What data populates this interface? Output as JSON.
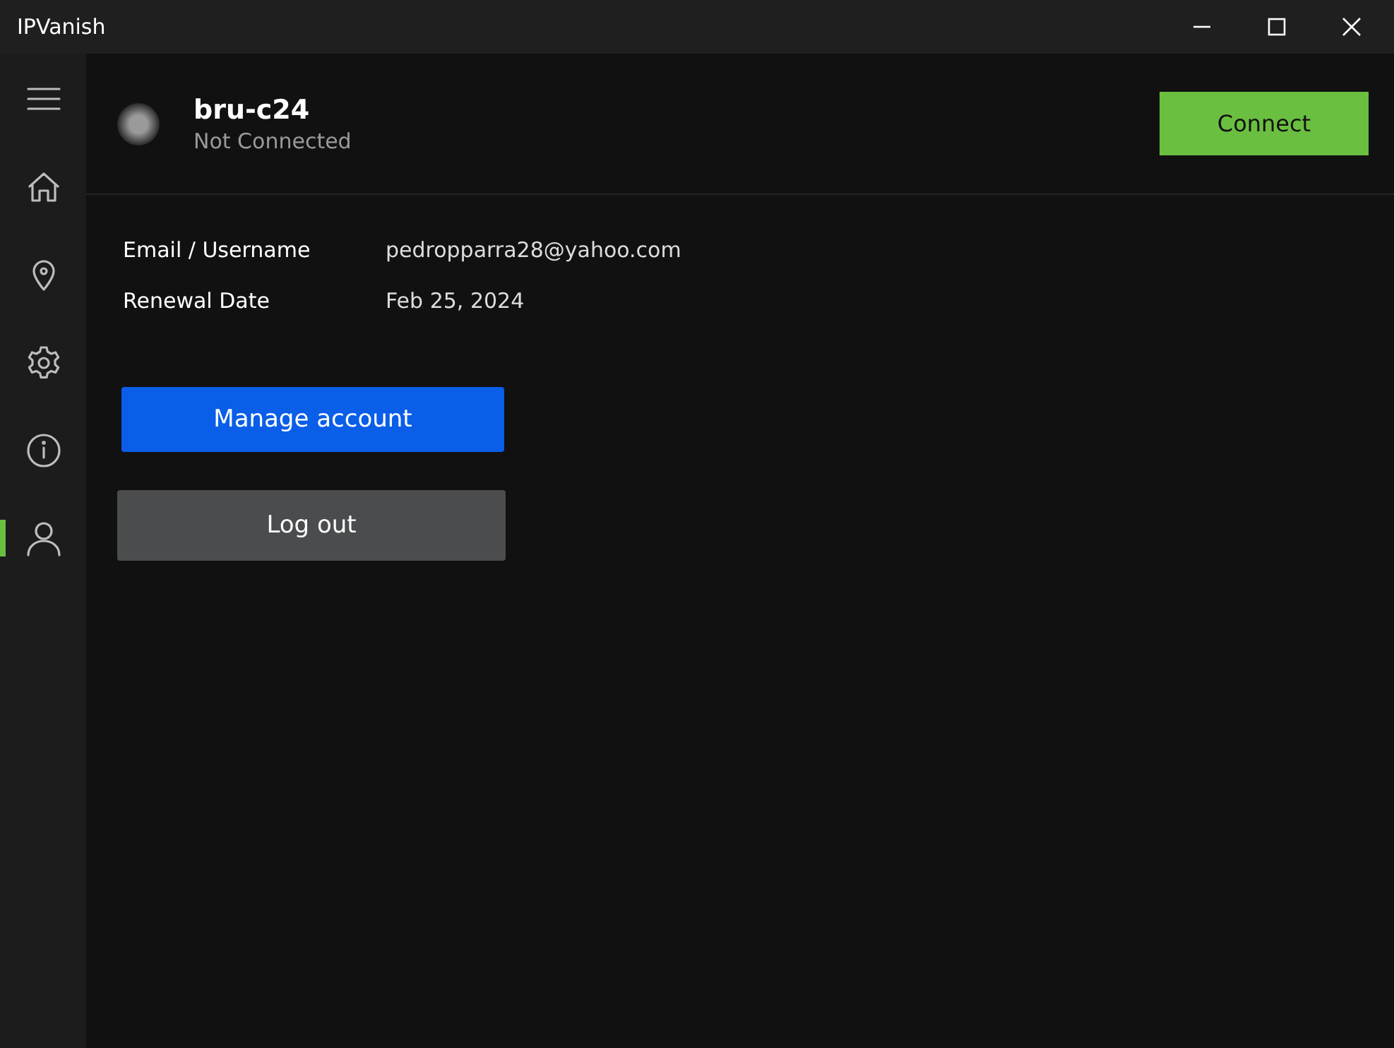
{
  "window": {
    "title": "IPVanish",
    "controls": [
      {
        "kind": "minimize"
      },
      {
        "kind": "maximize"
      },
      {
        "kind": "close"
      }
    ]
  },
  "sidebar": {
    "items": [
      {
        "kind": "menu",
        "selected": false
      },
      {
        "kind": "home",
        "selected": false
      },
      {
        "kind": "location",
        "selected": false
      },
      {
        "kind": "settings",
        "selected": false
      },
      {
        "kind": "info",
        "selected": false
      },
      {
        "kind": "account",
        "selected": true
      }
    ]
  },
  "header": {
    "server": "bru-c24",
    "status": "Not Connected",
    "connected": false,
    "button": "Connect"
  },
  "account": {
    "fields": [
      {
        "label": "Email / Username",
        "value": "pedropparra28@yahoo.com"
      },
      {
        "label": "Renewal Date",
        "value": "Feb 25, 2024"
      }
    ],
    "buttons": [
      {
        "label": "Manage account",
        "kind": "primary"
      },
      {
        "label": "Log out",
        "kind": "secondary"
      }
    ]
  }
}
